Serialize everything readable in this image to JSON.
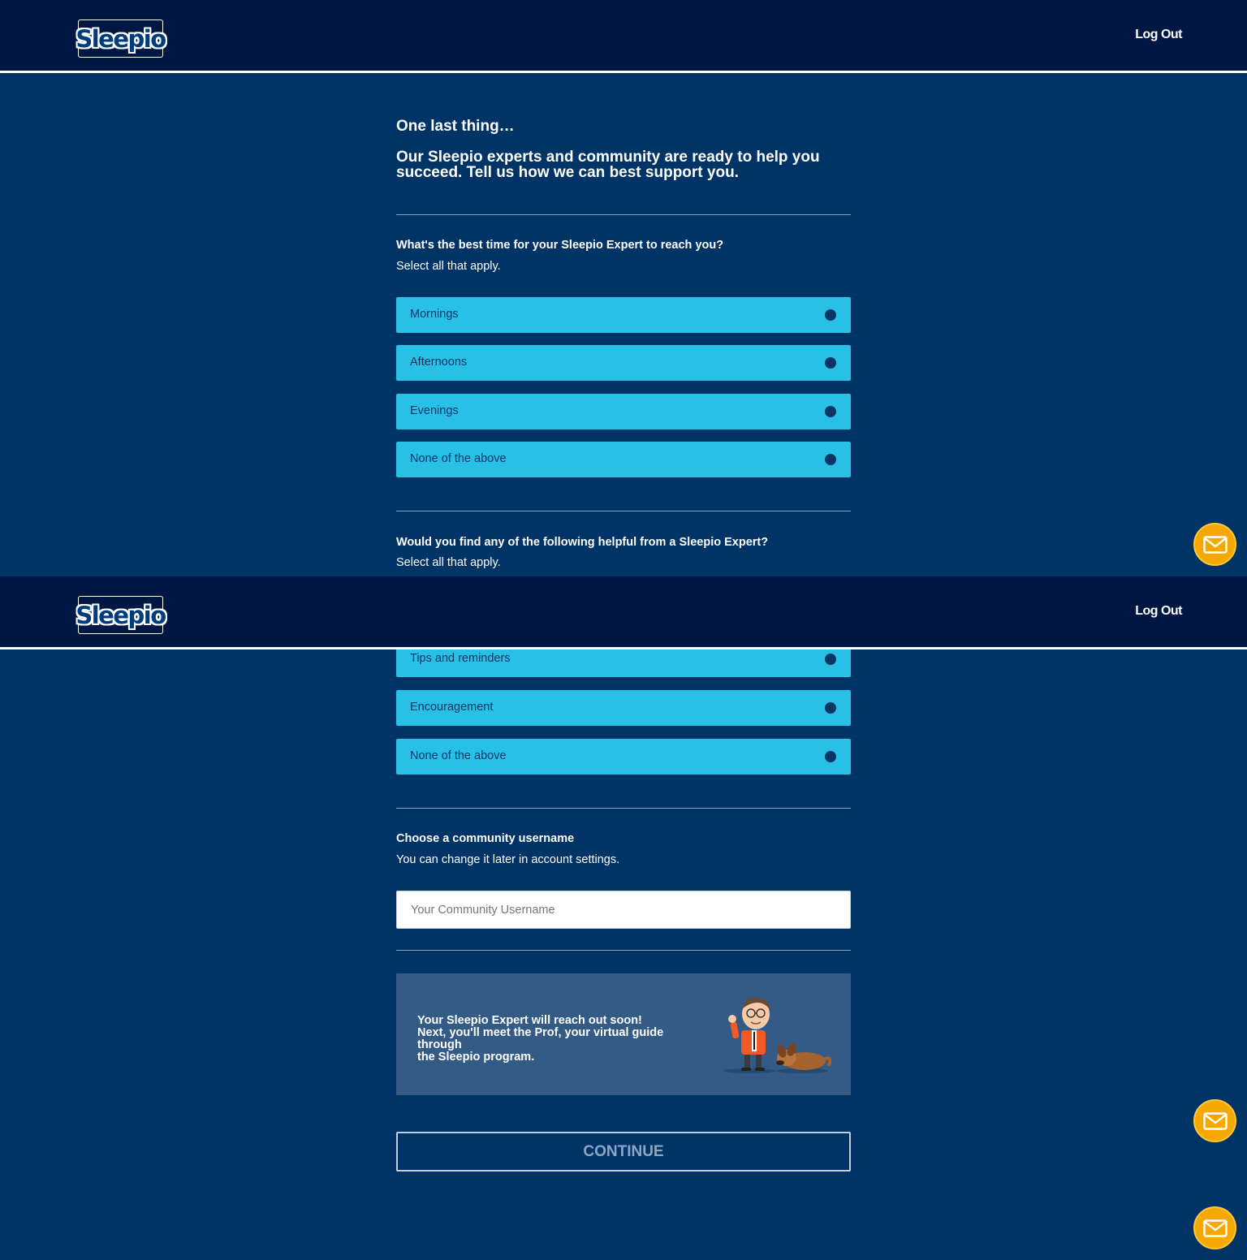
{
  "header": {
    "logo_text": "Sleepio",
    "logout_label": "Log Out"
  },
  "intro": {
    "title": "One last thing…",
    "subtitle_line1": "Our Sleepio experts and community are ready to help you",
    "subtitle_line2": "succeed. Tell us how we can best support you."
  },
  "time_question": {
    "question": "What's the best time for your Sleepio Expert to reach you?",
    "hint": "Select all that apply.",
    "options": [
      "Mornings",
      "Afternoons",
      "Evenings",
      "None of the above"
    ]
  },
  "help_question": {
    "question": "Would you find any of the following helpful from a Sleepio Expert?",
    "hint": "Select all that apply.",
    "options": [
      "Tips and reminders",
      "Encouragement",
      "None of the above"
    ]
  },
  "username": {
    "label": "Choose a community username",
    "hint": "You can change it later in account settings.",
    "placeholder": "Your Community Username"
  },
  "info_card": {
    "line1": "Your Sleepio Expert will reach out soon!",
    "line2": "Next, you'll meet the Prof, your virtual guide through",
    "line3": "the Sleepio program."
  },
  "continue_label": "CONTINUE",
  "colors": {
    "header_bg": "#001744",
    "page_bg": "#003366",
    "option_bg": "#29c0e6",
    "accent": "#f5a800"
  },
  "icons": {
    "mail": "mail-icon",
    "option_indicator": "dot-icon"
  }
}
